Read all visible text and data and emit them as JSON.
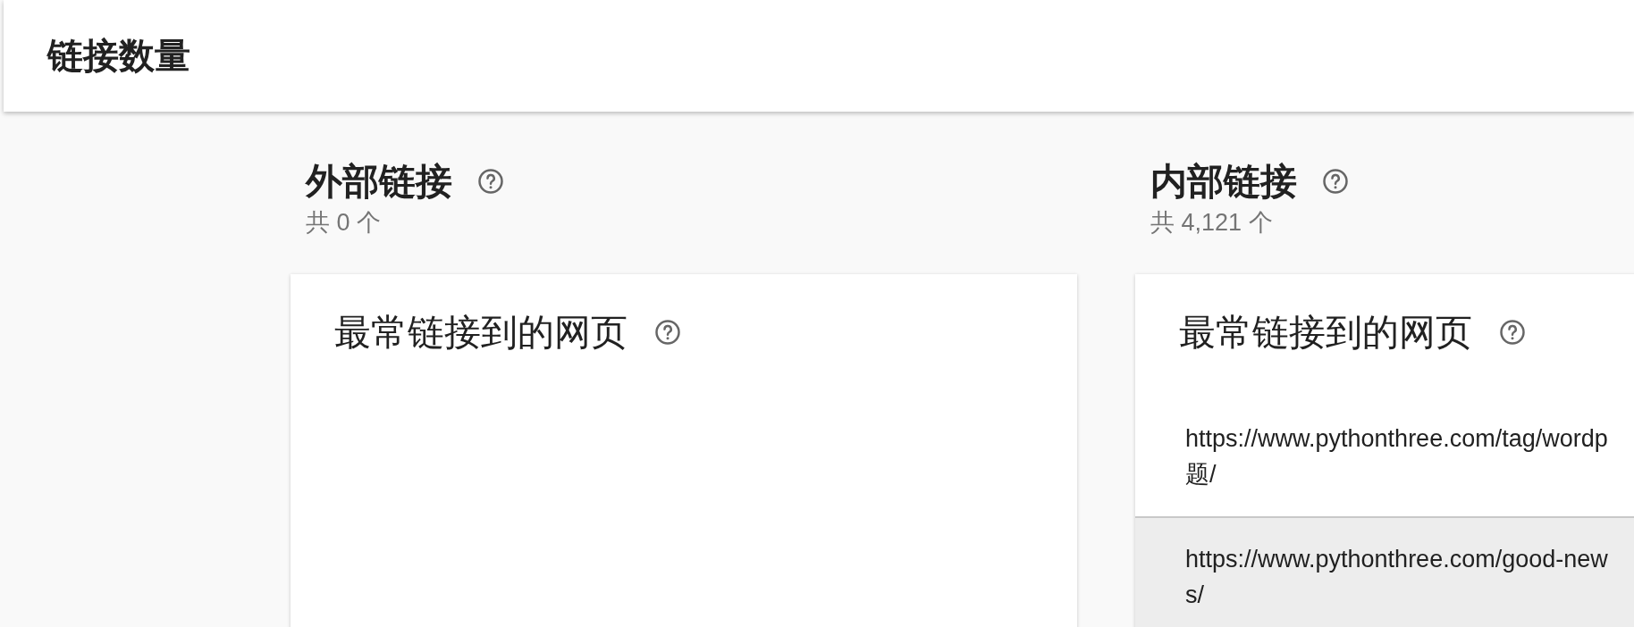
{
  "header": {
    "title": "链接数量"
  },
  "sections": [
    {
      "title": "外部链接",
      "count": "共 0 个",
      "card": {
        "title": "最常链接到的网页"
      }
    },
    {
      "title": "内部链接",
      "count": "共 4,121 个",
      "card": {
        "title": "最常链接到的网页",
        "rows": [
          {
            "text": "https://www.pythonthree.com/tag/wordp\n题/",
            "highlighted": false
          },
          {
            "text": "https://www.pythonthree.com/good-new\ns/",
            "highlighted": true
          }
        ]
      }
    }
  ]
}
